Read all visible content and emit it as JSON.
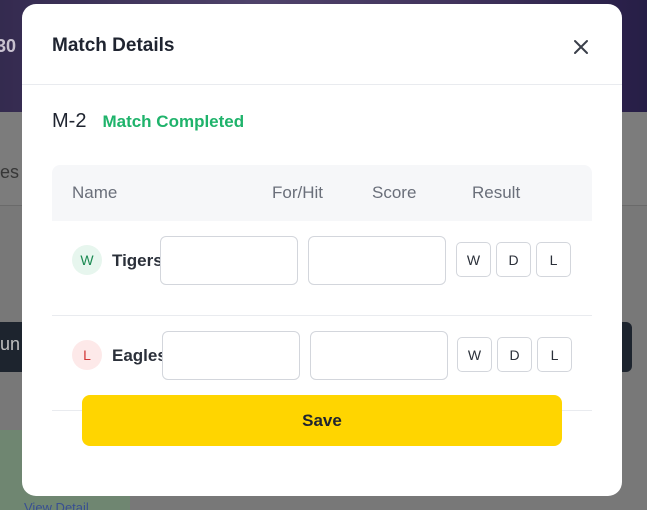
{
  "background": {
    "banner_subtext": "30",
    "tab_text": "les",
    "dark_button_text": "un",
    "link_text": "View Detail"
  },
  "modal": {
    "title": "Match Details",
    "close_icon": "close-icon",
    "match_id": "M-2",
    "status": "Match Completed",
    "columns": [
      "Name",
      "For/Hit",
      "Score",
      "Result"
    ],
    "rows": [
      {
        "badge": "W",
        "team": "Tigers",
        "for_hit": "",
        "score": "",
        "results": [
          "W",
          "D",
          "L"
        ]
      },
      {
        "badge": "L",
        "team": "Eagles",
        "for_hit": "",
        "score": "",
        "results": [
          "W",
          "D",
          "L"
        ]
      }
    ],
    "save_label": "Save"
  },
  "colors": {
    "status_green": "#1fb36b",
    "save_yellow": "#ffd500",
    "win_badge": "#1b8a52",
    "loss_badge": "#d23b3b"
  }
}
